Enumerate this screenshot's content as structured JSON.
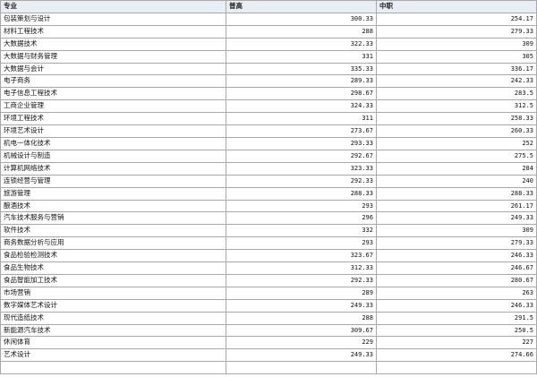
{
  "table": {
    "headers": [
      "专业",
      "普高",
      "中职"
    ],
    "rows": [
      [
        "包装策划与设计",
        "300.33",
        "254.17"
      ],
      [
        "材料工程技术",
        "288",
        "279.33"
      ],
      [
        "大数据技术",
        "322.33",
        "309"
      ],
      [
        "大数据与财务管理",
        "331",
        "305"
      ],
      [
        "大数据与会计",
        "335.33",
        "336.17"
      ],
      [
        "电子商务",
        "289.33",
        "242.33"
      ],
      [
        "电子信息工程技术",
        "298.67",
        "283.5"
      ],
      [
        "工商企业管理",
        "324.33",
        "312.5"
      ],
      [
        "环境工程技术",
        "311",
        "258.33"
      ],
      [
        "环境艺术设计",
        "273.67",
        "260.33"
      ],
      [
        "机电一体化技术",
        "293.33",
        "252"
      ],
      [
        "机械设计与制造",
        "292.67",
        "275.5"
      ],
      [
        "计算机网络技术",
        "323.33",
        "284"
      ],
      [
        "连锁经营与管理",
        "292.33",
        "240"
      ],
      [
        "旅游管理",
        "288.33",
        "288.33"
      ],
      [
        "酿酒技术",
        "293",
        "261.17"
      ],
      [
        "汽车技术服务与营销",
        "296",
        "249.33"
      ],
      [
        "软件技术",
        "332",
        "309"
      ],
      [
        "商务数据分析与应用",
        "293",
        "279.33"
      ],
      [
        "食品检验检测技术",
        "323.67",
        "246.33"
      ],
      [
        "食品生物技术",
        "312.33",
        "246.67"
      ],
      [
        "食品智能加工技术",
        "292.33",
        "280.67"
      ],
      [
        "市场营销",
        "289",
        "263"
      ],
      [
        "数字媒体艺术设计",
        "249.33",
        "246.33"
      ],
      [
        "现代造纸技术",
        "288",
        "291.5"
      ],
      [
        "新能源汽车技术",
        "309.67",
        "250.5"
      ],
      [
        "休闲体育",
        "229",
        "227"
      ],
      [
        "艺术设计",
        "249.33",
        "274.66"
      ],
      [
        "",
        "",
        ""
      ]
    ]
  }
}
